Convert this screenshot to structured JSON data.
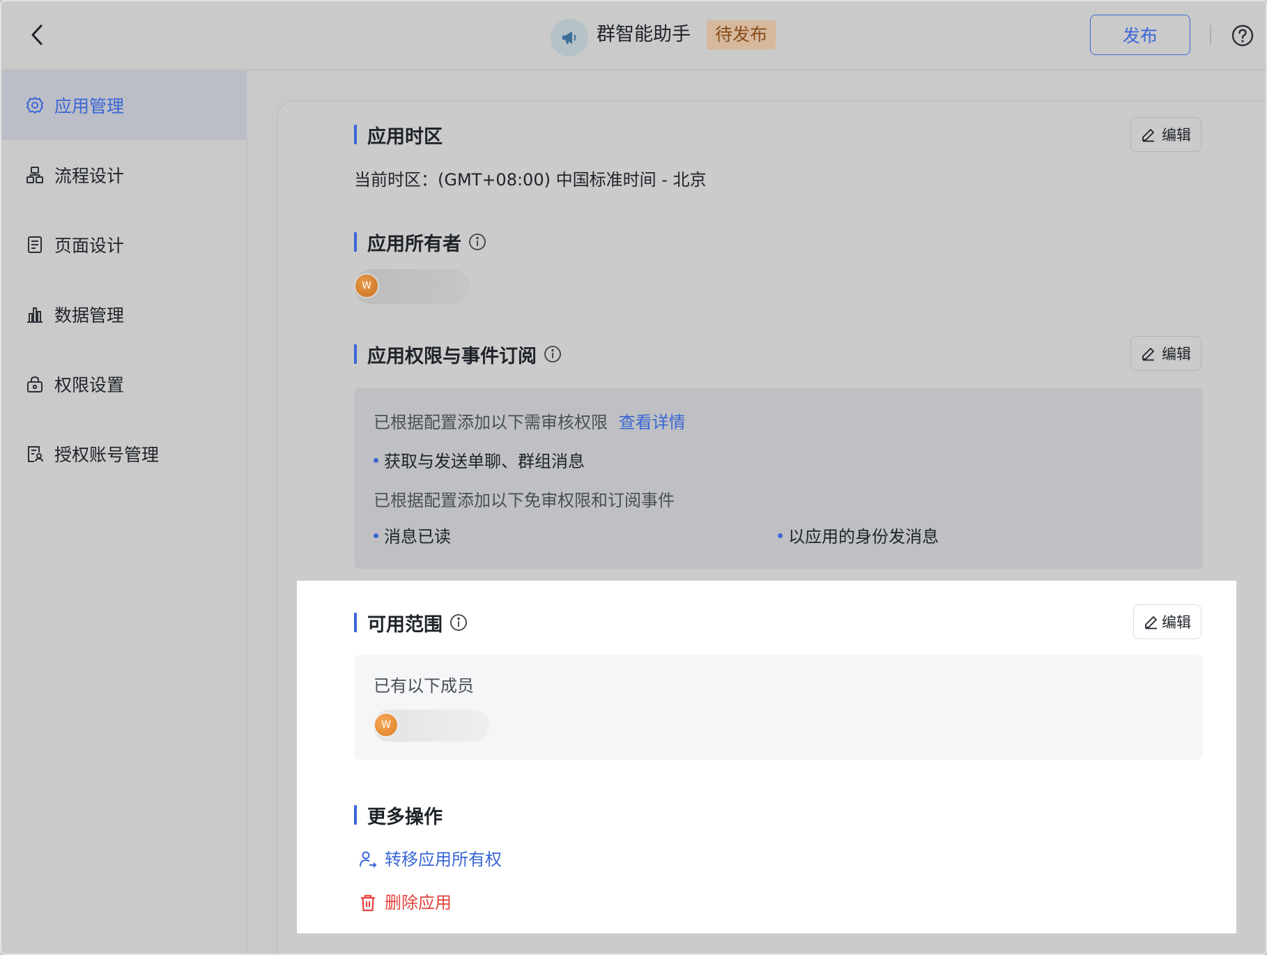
{
  "header": {
    "app_name": "群智能助手",
    "status": "待发布",
    "publish_label": "发布"
  },
  "sidebar": {
    "items": [
      {
        "label": "应用管理",
        "icon": "gear-icon",
        "active": true
      },
      {
        "label": "流程设计",
        "icon": "flow-icon",
        "active": false
      },
      {
        "label": "页面设计",
        "icon": "page-icon",
        "active": false
      },
      {
        "label": "数据管理",
        "icon": "chart-icon",
        "active": false
      },
      {
        "label": "权限设置",
        "icon": "lock-icon",
        "active": false
      },
      {
        "label": "授权账号管理",
        "icon": "account-icon",
        "active": false
      }
    ]
  },
  "sections": {
    "timezone": {
      "title": "应用时区",
      "edit_label": "编辑",
      "text": "当前时区：(GMT+08:00) 中国标准时间 - 北京"
    },
    "owner": {
      "title": "应用所有者",
      "avatar_letter": "W"
    },
    "permissions": {
      "title": "应用权限与事件订阅",
      "edit_label": "编辑",
      "review_intro": "已根据配置添加以下需审核权限",
      "view_details": "查看详情",
      "review_items": [
        "获取与发送单聊、群组消息"
      ],
      "free_intro": "已根据配置添加以下免审权限和订阅事件",
      "free_items": [
        "消息已读",
        "以应用的身份发消息"
      ]
    },
    "scope": {
      "title": "可用范围",
      "edit_label": "编辑",
      "members_intro": "已有以下成员",
      "avatar_letter": "W"
    },
    "more": {
      "title": "更多操作",
      "transfer_label": "转移应用所有权",
      "delete_label": "删除应用"
    }
  },
  "colors": {
    "accent": "#3a66d6",
    "danger": "#e0443c",
    "badge_bg": "#d6b99c",
    "overlay": "#c9c9c9"
  }
}
